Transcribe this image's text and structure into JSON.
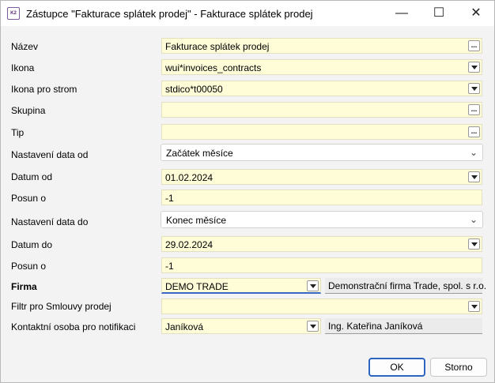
{
  "window": {
    "title": "Zástupce \"Fakturace splátek prodej\" - Fakturace splátek prodej",
    "app_icon_text": "K2",
    "minimize_glyph": "—",
    "maximize_glyph": "☐",
    "close_glyph": "✕"
  },
  "form": {
    "nazev": {
      "label": "Název",
      "value": "Fakturace splátek prodej"
    },
    "ikona": {
      "label": "Ikona",
      "value": "wui*invoices_contracts"
    },
    "ikona_strom": {
      "label": "Ikona pro strom",
      "value": "stdico*t00050"
    },
    "skupina": {
      "label": "Skupina",
      "value": ""
    },
    "tip": {
      "label": "Tip",
      "value": ""
    },
    "nastaveni_od": {
      "label": "Nastavení data od",
      "value": "Začátek měsíce"
    },
    "datum_od": {
      "label": "Datum od",
      "value": "01.02.2024"
    },
    "posun_od": {
      "label": "Posun o",
      "value": "-1"
    },
    "nastaveni_do": {
      "label": "Nastavení data do",
      "value": "Konec měsíce"
    },
    "datum_do": {
      "label": "Datum do",
      "value": "29.02.2024"
    },
    "posun_do": {
      "label": "Posun o",
      "value": "-1"
    },
    "firma": {
      "label": "Firma",
      "value": "DEMO TRADE",
      "description": "Demonstrační firma Trade, spol. s r.o."
    },
    "filtr": {
      "label": "Filtr pro Smlouvy prodej",
      "value": ""
    },
    "kontakt": {
      "label": "Kontaktní osoba pro notifikaci",
      "value": "Janíková",
      "description": "Ing. Kateřina Janíková"
    }
  },
  "buttons": {
    "ok": "OK",
    "cancel": "Storno",
    "ellipsis": "..."
  },
  "icons": {
    "dropdown": "chevron-down-icon",
    "ellipsis": "ellipsis-icon"
  },
  "colors": {
    "field_bg": "#fffdd8",
    "accent": "#2b65c0"
  }
}
